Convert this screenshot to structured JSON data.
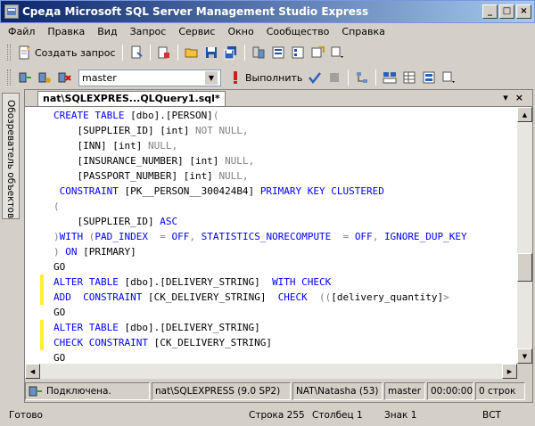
{
  "window": {
    "title": "Среда Microsoft SQL Server Management Studio Express",
    "buttons": {
      "minimize": "_",
      "maximize": "□",
      "close": "×"
    }
  },
  "menu": [
    "Файл",
    "Правка",
    "Вид",
    "Запрос",
    "Сервис",
    "Окно",
    "Сообщество",
    "Справка"
  ],
  "toolbar1": {
    "new_query_label": "Создать запрос",
    "icons": [
      "new-query-icon",
      "new-file-icon",
      "new-project-icon",
      "open-folder-icon",
      "save-icon",
      "save-all-icon",
      "object-explorer-icon",
      "properties-icon",
      "registered-servers-icon",
      "template-icon",
      "toolbar-options-icon"
    ]
  },
  "toolbar2": {
    "database": "master",
    "execute_label": "Выполнить",
    "icons": [
      "connect-icon",
      "change-connection-icon",
      "disconnect-icon",
      "execute-icon",
      "parse-icon",
      "cancel-icon",
      "include-plan-icon",
      "results-to-text-icon",
      "results-to-grid-icon",
      "results-to-file-icon"
    ]
  },
  "sidebar": {
    "object_explorer_label": "Обозреватель объектов"
  },
  "document": {
    "tab_title": "nat\\SQLEXPRES...QLQuery1.sql*",
    "tab_controls": [
      "▾",
      "×"
    ],
    "code": [
      [
        [
          "CREATE TABLE ",
          "kw"
        ],
        [
          "[dbo].[PERSON]",
          ""
        ],
        [
          "(",
          "gy"
        ]
      ],
      [
        [
          "    [SUPPLIER_ID] [int] ",
          ""
        ],
        [
          "NOT NULL,",
          "gy"
        ]
      ],
      [
        [
          "    [INN] [int] ",
          ""
        ],
        [
          "NULL,",
          "gy"
        ]
      ],
      [
        [
          "    [INSURANCE_NUMBER] [int] ",
          ""
        ],
        [
          "NULL,",
          "gy"
        ]
      ],
      [
        [
          "    [PASSPORT_NUMBER] [int] ",
          ""
        ],
        [
          "NULL,",
          "gy"
        ]
      ],
      [
        [
          " CONSTRAINT ",
          "kw"
        ],
        [
          "[PK__PERSON__300424B4] ",
          ""
        ],
        [
          "PRIMARY KEY CLUSTERED",
          "kw"
        ]
      ],
      [
        [
          "(",
          "gy"
        ]
      ],
      [
        [
          "    [SUPPLIER_ID] ",
          ""
        ],
        [
          "ASC",
          "kw"
        ]
      ],
      [
        [
          ")",
          "gy"
        ],
        [
          "WITH ",
          "kw"
        ],
        [
          "(",
          "gy"
        ],
        [
          "PAD_INDEX  ",
          "kw"
        ],
        [
          "= ",
          "gy"
        ],
        [
          "OFF",
          "kw"
        ],
        [
          ", ",
          "gy"
        ],
        [
          "STATISTICS_NORECOMPUTE  ",
          "kw"
        ],
        [
          "= ",
          "gy"
        ],
        [
          "OFF",
          "kw"
        ],
        [
          ", ",
          "gy"
        ],
        [
          "IGNORE_DUP_KEY",
          "kw"
        ]
      ],
      [
        [
          ") ",
          "gy"
        ],
        [
          "ON ",
          "kw"
        ],
        [
          "[PRIMARY]",
          ""
        ]
      ],
      [
        [
          "GO",
          ""
        ]
      ],
      [
        [
          "ALTER TABLE ",
          "kw"
        ],
        [
          "[dbo].[DELIVERY_STRING]  ",
          ""
        ],
        [
          "WITH CHECK",
          "kw"
        ]
      ],
      [
        [
          "ADD  ",
          "kw"
        ],
        [
          "CONSTRAINT ",
          "kw"
        ],
        [
          "[CK_DELIVERY_STRING]  ",
          ""
        ],
        [
          "CHECK  ",
          "kw"
        ],
        [
          "((",
          "gy"
        ],
        [
          "[delivery_quantity]",
          ""
        ],
        [
          ">",
          "gy"
        ]
      ],
      [
        [
          "GO",
          ""
        ]
      ],
      [
        [
          "ALTER TABLE ",
          "kw"
        ],
        [
          "[dbo].[DELIVERY_STRING]",
          ""
        ]
      ],
      [
        [
          "CHECK CONSTRAINT ",
          "kw"
        ],
        [
          "[CK_DELIVERY_STRING]",
          ""
        ]
      ],
      [
        [
          "GO",
          ""
        ]
      ]
    ],
    "marked_lines": [
      11,
      12,
      14,
      15
    ]
  },
  "query_status": {
    "connection": "Подключена.",
    "server": "nat\\SQLEXPRESS (9.0 SP2)",
    "user": "NAT\\Natasha (53)",
    "database": "master",
    "time": "00:00:00",
    "rows": "0 строк"
  },
  "status_bar": {
    "state": "Готово",
    "line": "Строка 255",
    "column": "Столбец 1",
    "char": "Знак 1",
    "mode": "ВСТ"
  },
  "colors": {
    "keyword": "#0000ff",
    "gray": "#808080",
    "marker": "#ffef28",
    "titlebar": "#0a246a"
  }
}
